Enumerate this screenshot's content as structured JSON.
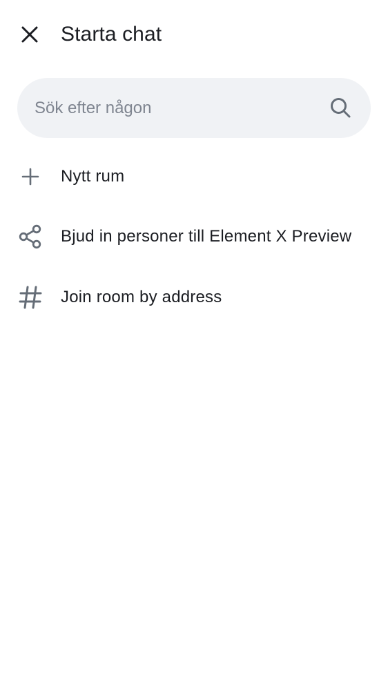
{
  "header": {
    "title": "Starta chat",
    "close_icon": "close-icon"
  },
  "search": {
    "placeholder": "Sök efter någon",
    "value": "",
    "icon": "search-icon"
  },
  "menu": {
    "items": [
      {
        "label": "Nytt rum",
        "icon": "plus-icon"
      },
      {
        "label": "Bjud in personer till Element X Preview",
        "icon": "share-icon"
      },
      {
        "label": "Join room by address",
        "icon": "hash-icon"
      }
    ]
  },
  "colors": {
    "background": "#ffffff",
    "text_primary": "#1b1d22",
    "icon_secondary": "#656d77",
    "search_background": "#f0f2f5",
    "placeholder": "#7f8590"
  }
}
